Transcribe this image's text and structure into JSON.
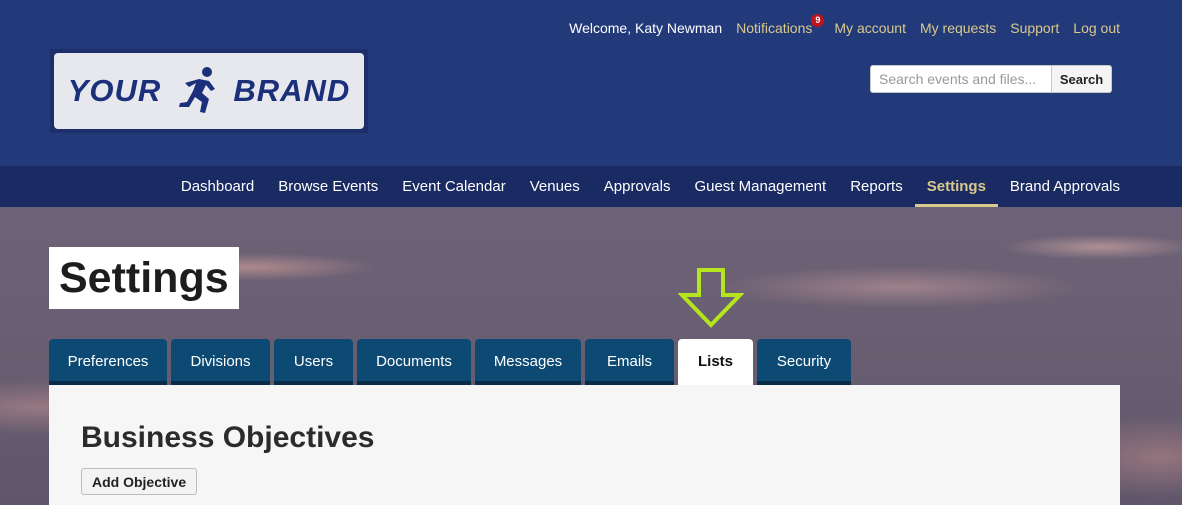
{
  "brand": {
    "logo_left": "YOUR",
    "logo_right": "BRAND"
  },
  "user_bar": {
    "welcome": "Welcome, Katy Newman",
    "notifications_label": "Notifications",
    "notifications_count": "9",
    "my_account": "My account",
    "my_requests": "My requests",
    "support": "Support",
    "log_out": "Log out"
  },
  "search": {
    "placeholder": "Search events and files...",
    "button_label": "Search"
  },
  "nav": {
    "items": [
      {
        "label": "Dashboard"
      },
      {
        "label": "Browse Events"
      },
      {
        "label": "Event Calendar"
      },
      {
        "label": "Venues"
      },
      {
        "label": "Approvals"
      },
      {
        "label": "Guest Management"
      },
      {
        "label": "Reports"
      },
      {
        "label": "Settings",
        "active": true
      },
      {
        "label": "Brand Approvals"
      }
    ]
  },
  "page": {
    "title": "Settings"
  },
  "tabs": [
    {
      "label": "Preferences"
    },
    {
      "label": "Divisions"
    },
    {
      "label": "Users"
    },
    {
      "label": "Documents"
    },
    {
      "label": "Messages"
    },
    {
      "label": "Emails"
    },
    {
      "label": "Lists",
      "active": true
    },
    {
      "label": "Security"
    }
  ],
  "content": {
    "section_title": "Business Objectives",
    "add_button": "Add Objective"
  },
  "colors": {
    "header_bg": "#233a7a",
    "nav_bg": "#1a2a63",
    "accent_gold": "#d9c98a",
    "tab_bg": "#0d4a73",
    "arrow_green": "#b5e61d",
    "badge_red": "#c0141c"
  },
  "icons": {
    "logo": "runner-icon",
    "pointer": "down-arrow-icon"
  }
}
